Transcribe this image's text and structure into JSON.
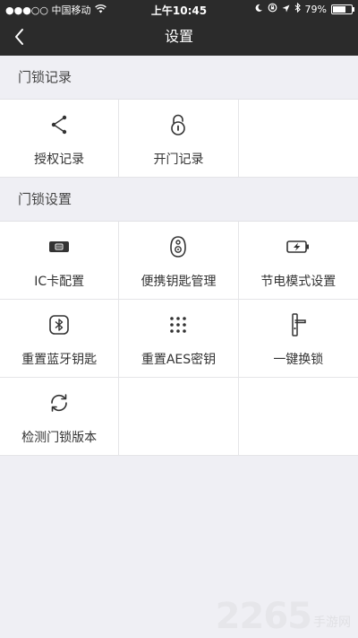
{
  "status_bar": {
    "carrier": "●●●○○ 中国移动",
    "time": "上午10:45",
    "battery": "79%",
    "battery_level": 0.79
  },
  "nav": {
    "title": "设置"
  },
  "sections": [
    {
      "title": "门锁记录",
      "items": [
        {
          "label": "授权记录",
          "icon": "share-icon"
        },
        {
          "label": "开门记录",
          "icon": "lock-icon"
        }
      ]
    },
    {
      "title": "门锁设置",
      "items": [
        {
          "label": "IC卡配置",
          "icon": "ic-card-icon"
        },
        {
          "label": "便携钥匙管理",
          "icon": "key-fob-icon"
        },
        {
          "label": "节电模式设置",
          "icon": "battery-saver-icon"
        },
        {
          "label": "重置蓝牙钥匙",
          "icon": "bluetooth-icon"
        },
        {
          "label": "重置AES密钥",
          "icon": "keypad-icon"
        },
        {
          "label": "一键换锁",
          "icon": "door-handle-icon"
        },
        {
          "label": "检测门锁版本",
          "icon": "refresh-icon"
        }
      ]
    }
  ],
  "watermark": {
    "number": "2265",
    "text": "手游网"
  }
}
